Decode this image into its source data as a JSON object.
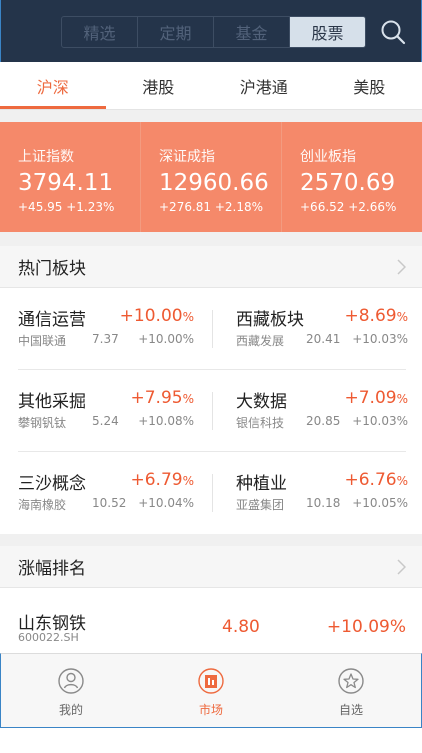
{
  "top_bar": {
    "segments": [
      "精选",
      "定期",
      "基金",
      "股票"
    ],
    "active_segment": "股票",
    "search_icon": "search-icon"
  },
  "market_tabs": {
    "items": [
      "沪深",
      "港股",
      "沪港通",
      "美股"
    ],
    "active": "沪深"
  },
  "indices": [
    {
      "name": "上证指数",
      "value": "3794.11",
      "change": "+45.95  +1.23%"
    },
    {
      "name": "深证成指",
      "value": "12960.66",
      "change": "+276.81  +2.18%"
    },
    {
      "name": "创业板指",
      "value": "2570.69",
      "change": "+66.52  +2.66%"
    }
  ],
  "hot_sectors": {
    "title": "热门板块",
    "chevron_icon": "chevron-right-icon",
    "items": [
      {
        "name": "通信运营",
        "change_num": "+10.00",
        "pct_sign": "%",
        "leader": "中国联通",
        "leader_price": "7.37",
        "leader_change": "+10.00%"
      },
      {
        "name": "西藏板块",
        "change_num": "+8.69",
        "pct_sign": "%",
        "leader": "西藏发展",
        "leader_price": "20.41",
        "leader_change": "+10.03%"
      },
      {
        "name": "其他采掘",
        "change_num": "+7.95",
        "pct_sign": "%",
        "leader": "攀钢钒钛",
        "leader_price": "5.24",
        "leader_change": "+10.08%"
      },
      {
        "name": "大数据",
        "change_num": "+7.09",
        "pct_sign": "%",
        "leader": "银信科技",
        "leader_price": "20.85",
        "leader_change": "+10.03%"
      },
      {
        "name": "三沙概念",
        "change_num": "+6.79",
        "pct_sign": "%",
        "leader": "海南橡胶",
        "leader_price": "10.52",
        "leader_change": "+10.04%"
      },
      {
        "name": "种植业",
        "change_num": "+6.76",
        "pct_sign": "%",
        "leader": "亚盛集团",
        "leader_price": "10.18",
        "leader_change": "+10.05%"
      }
    ]
  },
  "gainers": {
    "title": "涨幅排名",
    "chevron_icon": "chevron-right-icon",
    "items": [
      {
        "name": "山东钢铁",
        "code": "600022.SH",
        "price": "4.80",
        "change": "+10.09%"
      }
    ]
  },
  "bottom_nav": {
    "items": [
      {
        "label": "我的",
        "icon": "profile-icon"
      },
      {
        "label": "市场",
        "icon": "market-icon"
      },
      {
        "label": "自选",
        "icon": "favorites-star-icon"
      }
    ],
    "active": "市场"
  },
  "colors": {
    "accent": "#ee6a3f",
    "index_band": "#f5896a",
    "top_bar": "#24344a",
    "rise": "#ee5a32"
  }
}
